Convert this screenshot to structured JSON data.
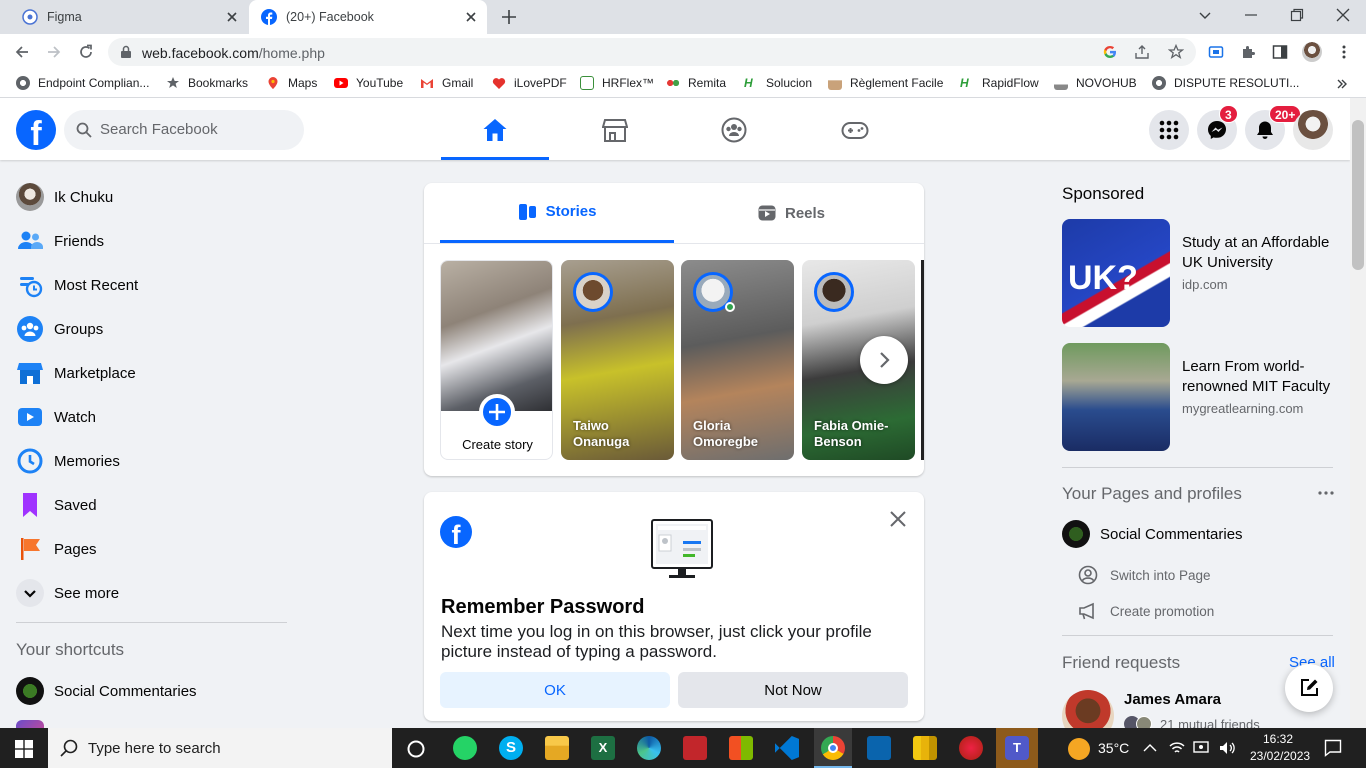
{
  "browser": {
    "tabs": [
      {
        "title": "Figma",
        "active": false
      },
      {
        "title": "(20+) Facebook",
        "active": true
      }
    ],
    "url_host": "web.facebook.com",
    "url_path": "/home.php",
    "bookmarks": [
      "Endpoint Complian...",
      "Bookmarks",
      "Maps",
      "YouTube",
      "Gmail",
      "iLovePDF",
      "HRFlex™",
      "Remita",
      "Solucion",
      "Règlement Facile",
      "RapidFlow",
      "NOVOHUB",
      "DISPUTE RESOLUTI..."
    ]
  },
  "header": {
    "search_placeholder": "Search Facebook",
    "messenger_badge": "3",
    "notifications_badge": "20+"
  },
  "sidebar": {
    "items": [
      {
        "label": "Ik Chuku",
        "icon": "profile-avatar"
      },
      {
        "label": "Friends",
        "icon": "friends-icon"
      },
      {
        "label": "Most Recent",
        "icon": "most-recent-icon"
      },
      {
        "label": "Groups",
        "icon": "groups-icon"
      },
      {
        "label": "Marketplace",
        "icon": "marketplace-icon"
      },
      {
        "label": "Watch",
        "icon": "watch-icon"
      },
      {
        "label": "Memories",
        "icon": "memories-icon"
      },
      {
        "label": "Saved",
        "icon": "saved-icon"
      },
      {
        "label": "Pages",
        "icon": "pages-icon"
      },
      {
        "label": "See more",
        "icon": "chevron-down-icon"
      }
    ],
    "shortcuts_heading": "Your shortcuts",
    "shortcuts": [
      {
        "label": "Social Commentaries"
      }
    ]
  },
  "stories": {
    "tabs": [
      "Stories",
      "Reels"
    ],
    "create_label": "Create story",
    "items": [
      {
        "name": "Taiwo Onanuga"
      },
      {
        "name": "Gloria Omoregbe"
      },
      {
        "name": "Fabia Omie-Benson"
      }
    ]
  },
  "password_prompt": {
    "title": "Remember Password",
    "text": "Next time you log in on this browser, just click your profile picture instead of typing a password.",
    "ok_label": "OK",
    "not_now_label": "Not Now"
  },
  "right": {
    "sponsored_heading": "Sponsored",
    "ads": [
      {
        "title": "Study at an Affordable UK University",
        "domain": "idp.com"
      },
      {
        "title": "Learn From world-renowned MIT Faculty",
        "domain": "mygreatlearning.com"
      }
    ],
    "pages_heading": "Your Pages and profiles",
    "page_name": "Social Commentaries",
    "switch_label": "Switch into Page",
    "promotion_label": "Create promotion",
    "friend_requests_heading": "Friend requests",
    "see_all_label": "See all",
    "request_name": "James Amara",
    "request_mutual": "21 mutual friends"
  },
  "taskbar": {
    "search_placeholder": "Type here to search",
    "temperature": "35°C",
    "time": "16:32",
    "date": "23/02/2023"
  },
  "colors": {
    "facebook_blue": "#0866ff",
    "badge_red": "#e41e3f",
    "page_bg": "#f0f2f5"
  }
}
